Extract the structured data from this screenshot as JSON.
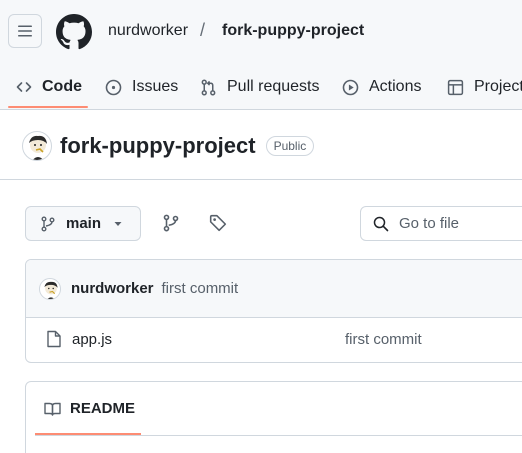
{
  "header": {
    "owner": "nurdworker",
    "separator": "/",
    "repo": "fork-puppy-project"
  },
  "nav": {
    "tabs": [
      {
        "label": "Code",
        "icon": "code-icon",
        "active": true
      },
      {
        "label": "Issues",
        "icon": "issue-opened-icon",
        "active": false
      },
      {
        "label": "Pull requests",
        "icon": "git-pull-request-icon",
        "active": false
      },
      {
        "label": "Actions",
        "icon": "play-icon",
        "active": false
      },
      {
        "label": "Projects",
        "icon": "table-icon",
        "active": false
      }
    ]
  },
  "repo": {
    "name": "fork-puppy-project",
    "visibility": "Public"
  },
  "toolbar": {
    "branch": "main",
    "goto_placeholder": "Go to file"
  },
  "latest_commit": {
    "author": "nurdworker",
    "message": "first commit"
  },
  "files": [
    {
      "name": "app.js",
      "commit_message": "first commit",
      "icon": "file-icon"
    }
  ],
  "readme": {
    "tab_label": "README"
  },
  "colors": {
    "accent_underline": "#fd8c73",
    "border": "#d0d7de",
    "muted_text": "#57606a",
    "header_bg": "#f6f8fa"
  }
}
